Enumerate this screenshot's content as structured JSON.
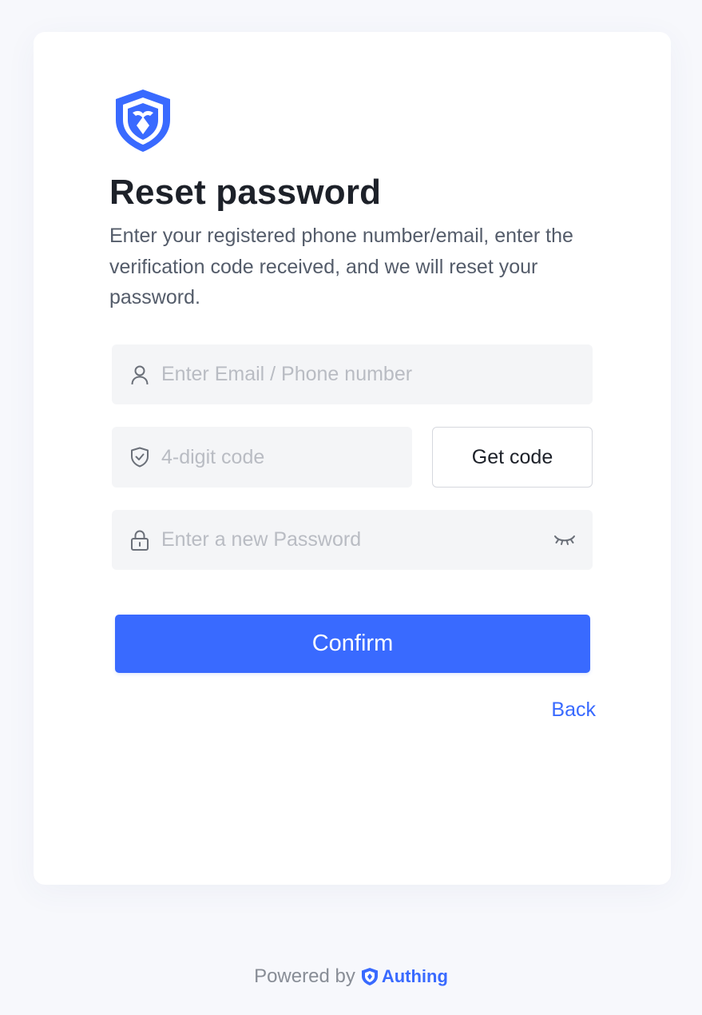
{
  "page": {
    "title": "Reset password",
    "subtitle": "Enter your registered phone number/email, enter the verification code received, and we will reset your password."
  },
  "form": {
    "account_placeholder": "Enter Email / Phone number",
    "code_placeholder": "4-digit code",
    "get_code_label": "Get code",
    "password_placeholder": "Enter a new Password",
    "confirm_label": "Confirm",
    "back_label": "Back"
  },
  "footer": {
    "powered_by": "Powered by",
    "brand": "Authing"
  },
  "icons": {
    "logo": "shield-logo-icon",
    "account": "user-icon",
    "code": "shield-check-icon",
    "password": "lock-icon",
    "toggle": "eye-closed-icon"
  },
  "colors": {
    "accent": "#396aff",
    "title": "#1d2129",
    "text": "#545c6a",
    "placeholder": "#b9bcc3",
    "field_bg": "#f4f5f7",
    "page_bg": "#f7f8fc"
  }
}
